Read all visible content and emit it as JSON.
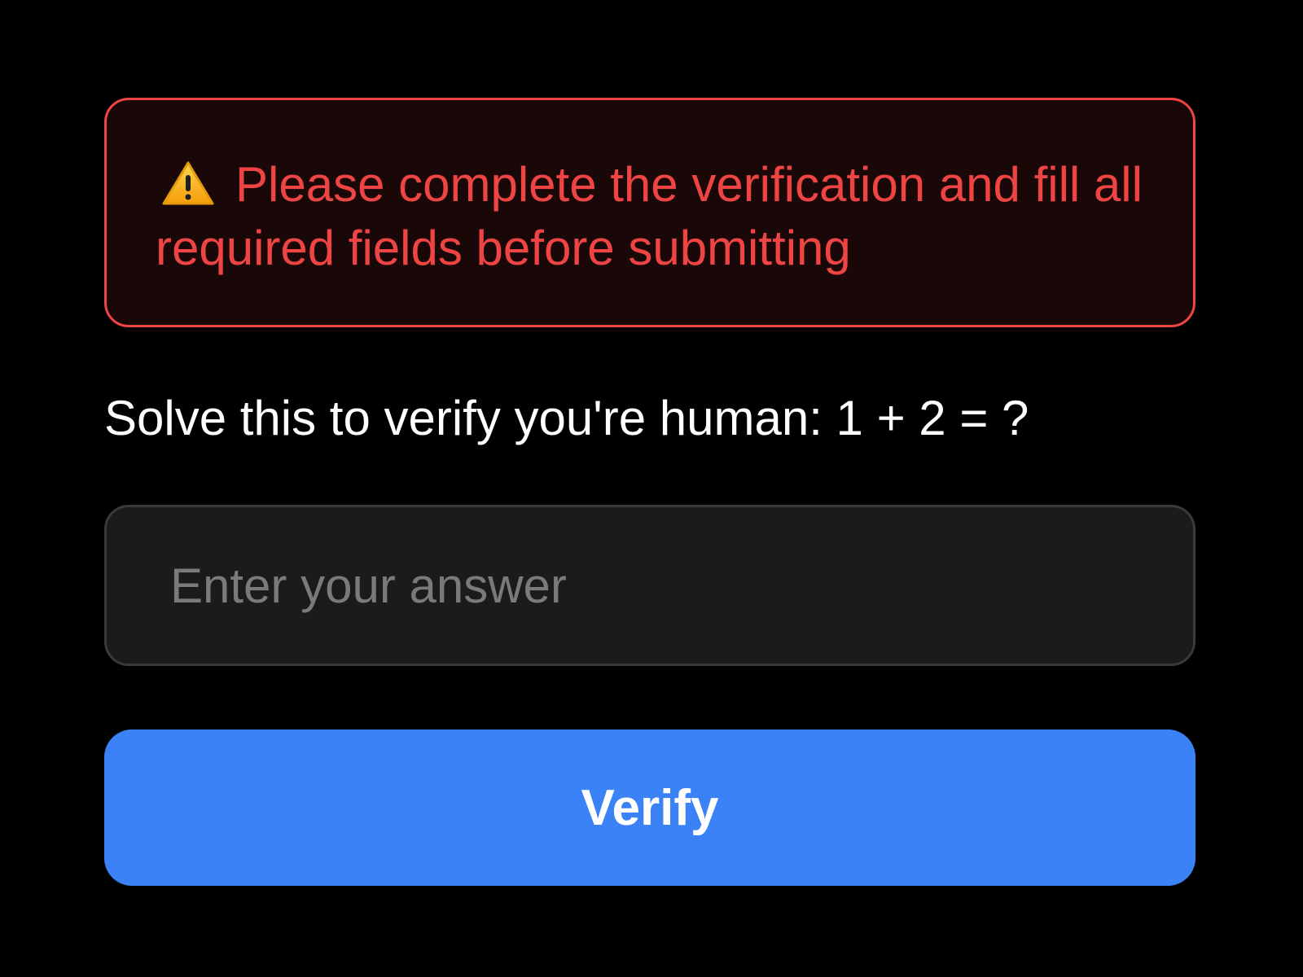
{
  "alert": {
    "icon": "warning-icon",
    "message": "Please complete the verification and fill all required fields before submitting",
    "color": "#ef4444"
  },
  "captcha": {
    "question": "Solve this to verify you're human: 1 + 2 = ?"
  },
  "answer_field": {
    "value": "",
    "placeholder": "Enter your answer"
  },
  "verify_button": {
    "label": "Verify",
    "color": "#3b82f6"
  }
}
